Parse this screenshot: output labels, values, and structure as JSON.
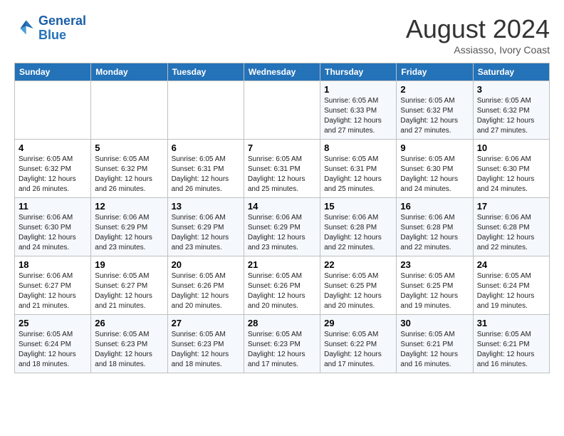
{
  "header": {
    "logo_general": "General",
    "logo_blue": "Blue",
    "month_year": "August 2024",
    "location": "Assiasso, Ivory Coast"
  },
  "weekdays": [
    "Sunday",
    "Monday",
    "Tuesday",
    "Wednesday",
    "Thursday",
    "Friday",
    "Saturday"
  ],
  "weeks": [
    [
      {
        "day": "",
        "sunrise": "",
        "sunset": "",
        "daylight": ""
      },
      {
        "day": "",
        "sunrise": "",
        "sunset": "",
        "daylight": ""
      },
      {
        "day": "",
        "sunrise": "",
        "sunset": "",
        "daylight": ""
      },
      {
        "day": "",
        "sunrise": "",
        "sunset": "",
        "daylight": ""
      },
      {
        "day": "1",
        "sunrise": "Sunrise: 6:05 AM",
        "sunset": "Sunset: 6:33 PM",
        "daylight": "Daylight: 12 hours and 27 minutes."
      },
      {
        "day": "2",
        "sunrise": "Sunrise: 6:05 AM",
        "sunset": "Sunset: 6:32 PM",
        "daylight": "Daylight: 12 hours and 27 minutes."
      },
      {
        "day": "3",
        "sunrise": "Sunrise: 6:05 AM",
        "sunset": "Sunset: 6:32 PM",
        "daylight": "Daylight: 12 hours and 27 minutes."
      }
    ],
    [
      {
        "day": "4",
        "sunrise": "Sunrise: 6:05 AM",
        "sunset": "Sunset: 6:32 PM",
        "daylight": "Daylight: 12 hours and 26 minutes."
      },
      {
        "day": "5",
        "sunrise": "Sunrise: 6:05 AM",
        "sunset": "Sunset: 6:32 PM",
        "daylight": "Daylight: 12 hours and 26 minutes."
      },
      {
        "day": "6",
        "sunrise": "Sunrise: 6:05 AM",
        "sunset": "Sunset: 6:31 PM",
        "daylight": "Daylight: 12 hours and 26 minutes."
      },
      {
        "day": "7",
        "sunrise": "Sunrise: 6:05 AM",
        "sunset": "Sunset: 6:31 PM",
        "daylight": "Daylight: 12 hours and 25 minutes."
      },
      {
        "day": "8",
        "sunrise": "Sunrise: 6:05 AM",
        "sunset": "Sunset: 6:31 PM",
        "daylight": "Daylight: 12 hours and 25 minutes."
      },
      {
        "day": "9",
        "sunrise": "Sunrise: 6:05 AM",
        "sunset": "Sunset: 6:30 PM",
        "daylight": "Daylight: 12 hours and 24 minutes."
      },
      {
        "day": "10",
        "sunrise": "Sunrise: 6:06 AM",
        "sunset": "Sunset: 6:30 PM",
        "daylight": "Daylight: 12 hours and 24 minutes."
      }
    ],
    [
      {
        "day": "11",
        "sunrise": "Sunrise: 6:06 AM",
        "sunset": "Sunset: 6:30 PM",
        "daylight": "Daylight: 12 hours and 24 minutes."
      },
      {
        "day": "12",
        "sunrise": "Sunrise: 6:06 AM",
        "sunset": "Sunset: 6:29 PM",
        "daylight": "Daylight: 12 hours and 23 minutes."
      },
      {
        "day": "13",
        "sunrise": "Sunrise: 6:06 AM",
        "sunset": "Sunset: 6:29 PM",
        "daylight": "Daylight: 12 hours and 23 minutes."
      },
      {
        "day": "14",
        "sunrise": "Sunrise: 6:06 AM",
        "sunset": "Sunset: 6:29 PM",
        "daylight": "Daylight: 12 hours and 23 minutes."
      },
      {
        "day": "15",
        "sunrise": "Sunrise: 6:06 AM",
        "sunset": "Sunset: 6:28 PM",
        "daylight": "Daylight: 12 hours and 22 minutes."
      },
      {
        "day": "16",
        "sunrise": "Sunrise: 6:06 AM",
        "sunset": "Sunset: 6:28 PM",
        "daylight": "Daylight: 12 hours and 22 minutes."
      },
      {
        "day": "17",
        "sunrise": "Sunrise: 6:06 AM",
        "sunset": "Sunset: 6:28 PM",
        "daylight": "Daylight: 12 hours and 22 minutes."
      }
    ],
    [
      {
        "day": "18",
        "sunrise": "Sunrise: 6:06 AM",
        "sunset": "Sunset: 6:27 PM",
        "daylight": "Daylight: 12 hours and 21 minutes."
      },
      {
        "day": "19",
        "sunrise": "Sunrise: 6:05 AM",
        "sunset": "Sunset: 6:27 PM",
        "daylight": "Daylight: 12 hours and 21 minutes."
      },
      {
        "day": "20",
        "sunrise": "Sunrise: 6:05 AM",
        "sunset": "Sunset: 6:26 PM",
        "daylight": "Daylight: 12 hours and 20 minutes."
      },
      {
        "day": "21",
        "sunrise": "Sunrise: 6:05 AM",
        "sunset": "Sunset: 6:26 PM",
        "daylight": "Daylight: 12 hours and 20 minutes."
      },
      {
        "day": "22",
        "sunrise": "Sunrise: 6:05 AM",
        "sunset": "Sunset: 6:25 PM",
        "daylight": "Daylight: 12 hours and 20 minutes."
      },
      {
        "day": "23",
        "sunrise": "Sunrise: 6:05 AM",
        "sunset": "Sunset: 6:25 PM",
        "daylight": "Daylight: 12 hours and 19 minutes."
      },
      {
        "day": "24",
        "sunrise": "Sunrise: 6:05 AM",
        "sunset": "Sunset: 6:24 PM",
        "daylight": "Daylight: 12 hours and 19 minutes."
      }
    ],
    [
      {
        "day": "25",
        "sunrise": "Sunrise: 6:05 AM",
        "sunset": "Sunset: 6:24 PM",
        "daylight": "Daylight: 12 hours and 18 minutes."
      },
      {
        "day": "26",
        "sunrise": "Sunrise: 6:05 AM",
        "sunset": "Sunset: 6:23 PM",
        "daylight": "Daylight: 12 hours and 18 minutes."
      },
      {
        "day": "27",
        "sunrise": "Sunrise: 6:05 AM",
        "sunset": "Sunset: 6:23 PM",
        "daylight": "Daylight: 12 hours and 18 minutes."
      },
      {
        "day": "28",
        "sunrise": "Sunrise: 6:05 AM",
        "sunset": "Sunset: 6:23 PM",
        "daylight": "Daylight: 12 hours and 17 minutes."
      },
      {
        "day": "29",
        "sunrise": "Sunrise: 6:05 AM",
        "sunset": "Sunset: 6:22 PM",
        "daylight": "Daylight: 12 hours and 17 minutes."
      },
      {
        "day": "30",
        "sunrise": "Sunrise: 6:05 AM",
        "sunset": "Sunset: 6:21 PM",
        "daylight": "Daylight: 12 hours and 16 minutes."
      },
      {
        "day": "31",
        "sunrise": "Sunrise: 6:05 AM",
        "sunset": "Sunset: 6:21 PM",
        "daylight": "Daylight: 12 hours and 16 minutes."
      }
    ]
  ]
}
